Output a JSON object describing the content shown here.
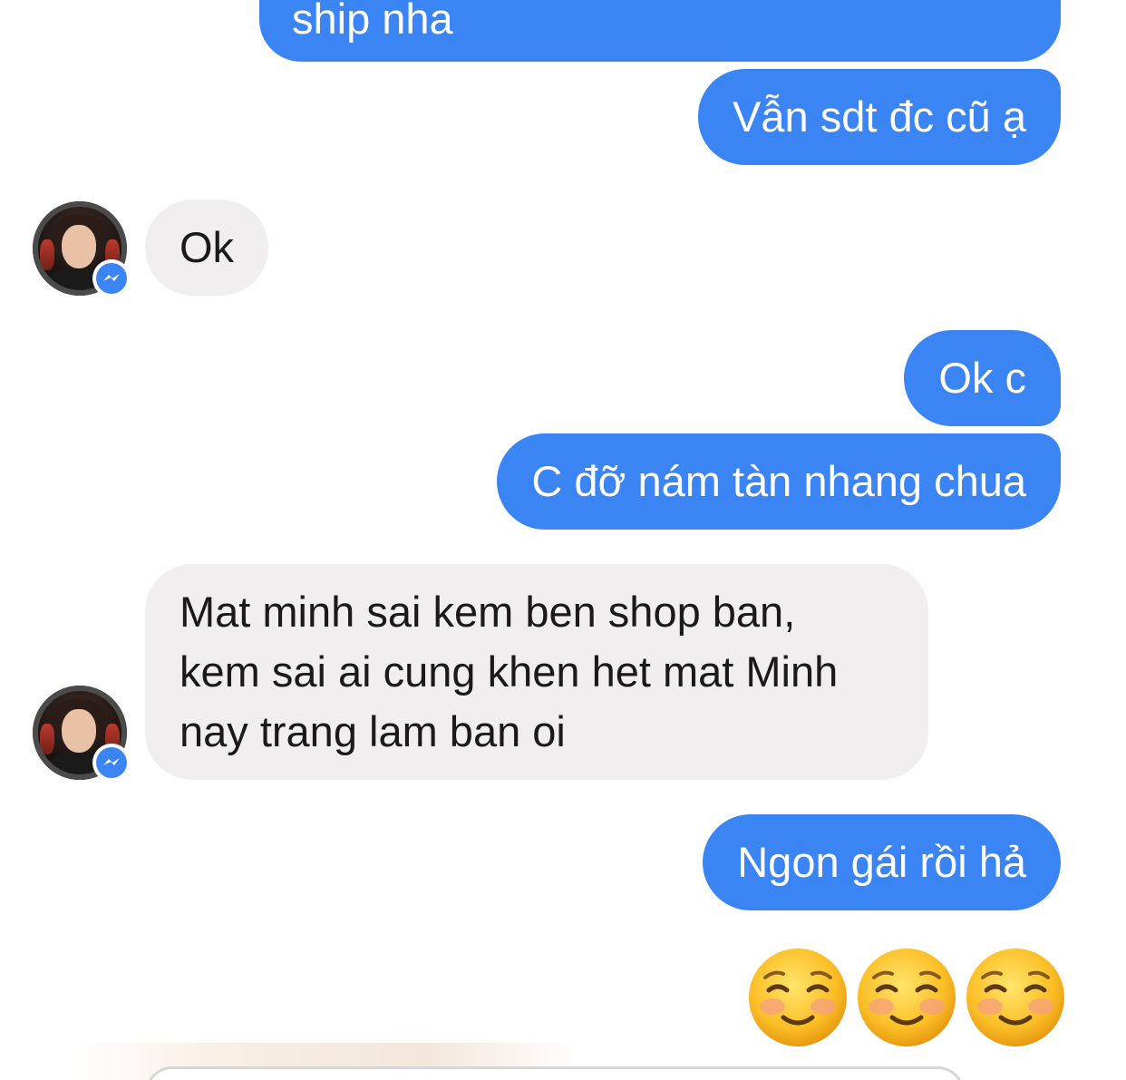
{
  "messages": [
    {
      "sender": "me",
      "text": "ship nha"
    },
    {
      "sender": "me",
      "text": "Vẫn sdt đc cũ ạ"
    },
    {
      "sender": "contact",
      "text": "Ok"
    },
    {
      "sender": "me",
      "text": "Ok c"
    },
    {
      "sender": "me",
      "text": "C đỡ nám tàn nhang chua"
    },
    {
      "sender": "contact",
      "lines": [
        "Mat minh sai kem ben shop ban,",
        "kem sai ai cung khen het mat Minh",
        "nay trang lam ban oi"
      ]
    },
    {
      "sender": "me",
      "text": "Ngon gái rồi hả"
    }
  ],
  "emoji_reply": {
    "sender": "me",
    "emoji": [
      "☺️",
      "☺️",
      "☺️"
    ],
    "icon": "smiling-face-icon"
  },
  "colors": {
    "outgoing_bubble": "#3b84f4",
    "incoming_bubble": "#f0eeee",
    "messenger_badge": "#3b84f4"
  },
  "icons": {
    "avatar_badge": "messenger-badge-icon"
  }
}
